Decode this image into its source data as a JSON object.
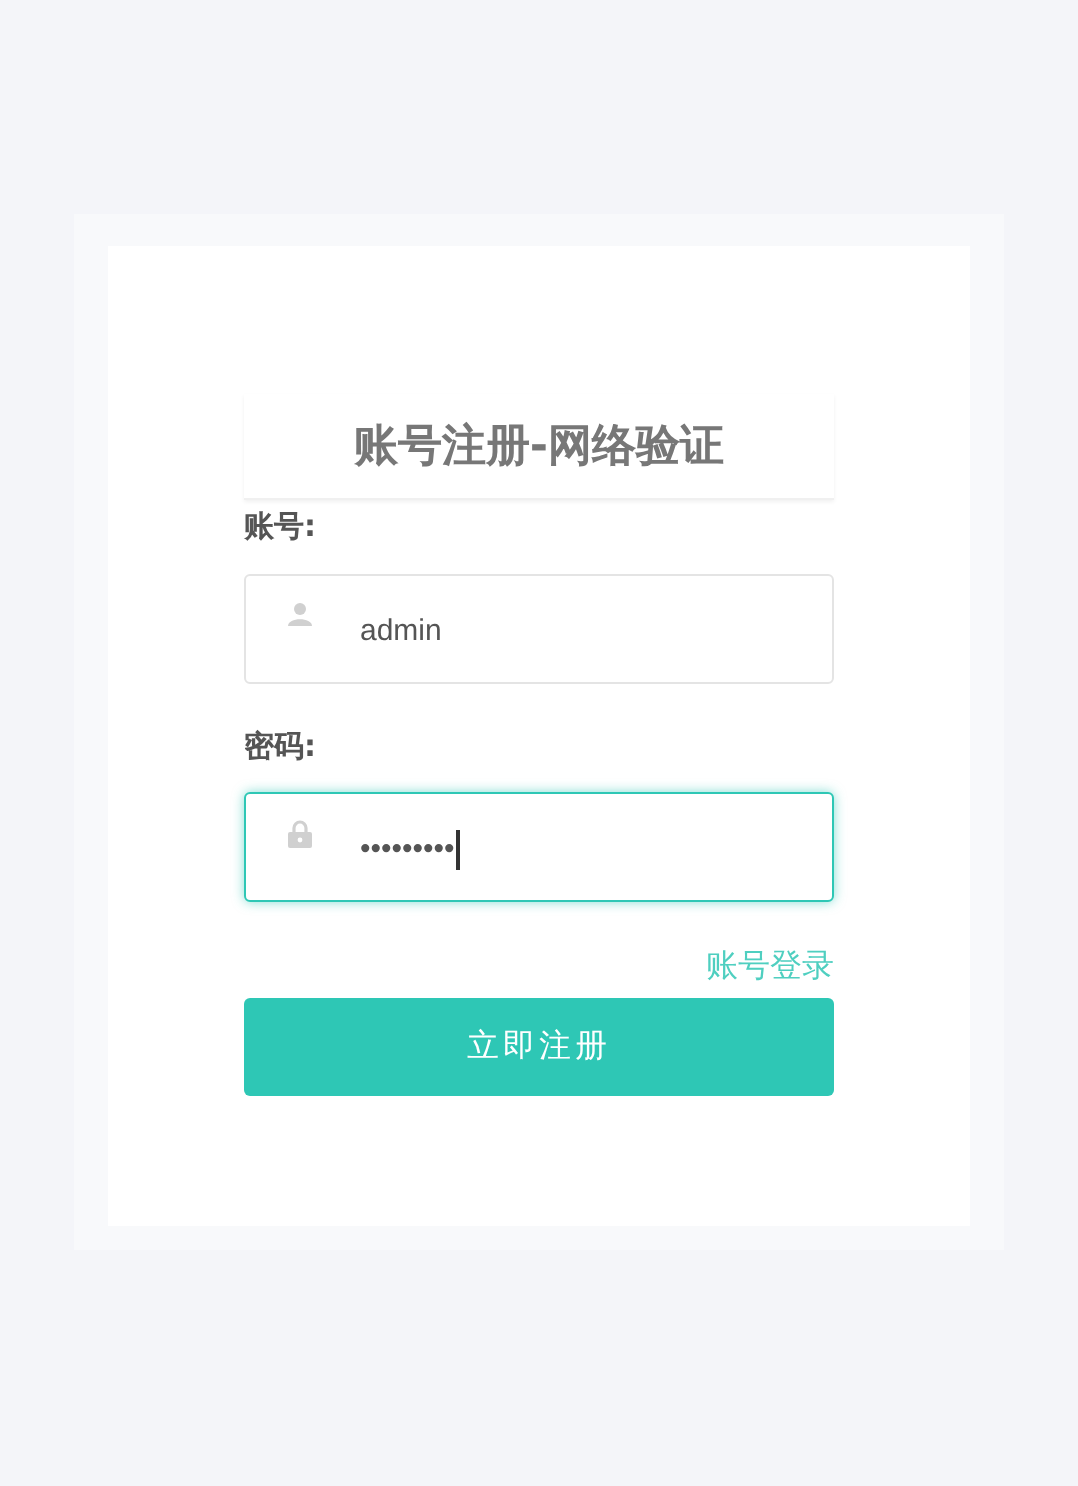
{
  "title": "账号注册-网络验证",
  "fields": [
    {
      "label": "账号:",
      "kind": "user",
      "value": "admin",
      "focused": false
    },
    {
      "label": "密码:",
      "kind": "password",
      "value": "•••••••••",
      "focused": true
    }
  ],
  "link": "账号登录",
  "submit": "立即注册"
}
